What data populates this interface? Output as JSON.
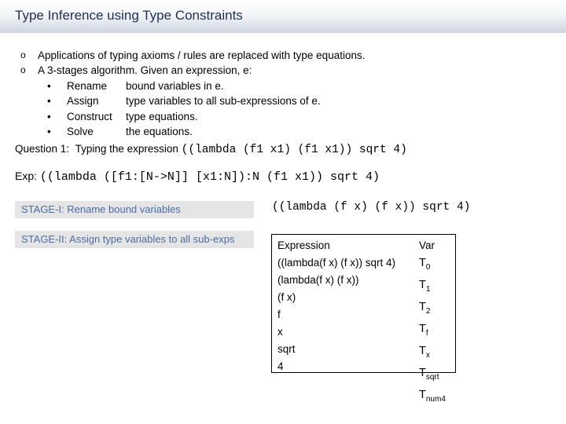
{
  "slide": {
    "title": "Type Inference using Type Constraints",
    "bullets": [
      {
        "marker": "o",
        "text": "Applications of typing axioms / rules are replaced with  type equations."
      },
      {
        "marker": "o",
        "text": "A 3-stages algorithm. Given an expression, e:"
      }
    ],
    "steps": [
      {
        "marker": "•",
        "term": "Rename",
        "desc": "bound variables in e."
      },
      {
        "marker": "•",
        "term": "Assign",
        "desc": "type variables to all sub-expressions of e."
      },
      {
        "marker": "•",
        "term": "Construct",
        "desc": "type equations."
      },
      {
        "marker": "•",
        "term": "Solve",
        "desc": "the equations."
      }
    ],
    "question": {
      "label": "Question 1:",
      "text": "Typing the expression",
      "code": "((lambda (f1 x1) (f1 x1)) sqrt 4)"
    },
    "exp": {
      "label": "Exp:",
      "code": "((lambda ([f1:[N->N]] [x1:N]):N (f1 x1)) sqrt 4)"
    },
    "stages": [
      {
        "label": "STAGE-I: Rename bound variables"
      },
      {
        "label": "STAGE-II: Assign type variables to all sub-exps"
      }
    ],
    "renamed_expression": "((lambda (f x) (f x)) sqrt 4)",
    "table": {
      "headers": {
        "expression": "Expression",
        "var": "Var"
      },
      "rows": [
        {
          "expression": "((lambda(f x) (f x)) sqrt 4)",
          "var_base": "T",
          "var_sub": "0"
        },
        {
          "expression": "(lambda(f x) (f x))",
          "var_base": "T",
          "var_sub": "1"
        },
        {
          "expression": "(f x)",
          "var_base": "T",
          "var_sub": "2"
        },
        {
          "expression": "f",
          "var_base": "T",
          "var_sub": "f"
        },
        {
          "expression": "x",
          "var_base": "T",
          "var_sub": "x"
        },
        {
          "expression": "sqrt",
          "var_base": "T",
          "var_sub": "sqrt"
        },
        {
          "expression": "4",
          "var_base": "T",
          "var_sub": "num4"
        }
      ]
    }
  }
}
